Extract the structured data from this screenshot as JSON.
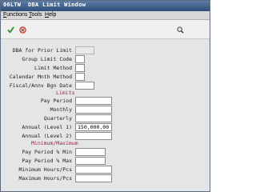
{
  "window": {
    "code": "06LTW",
    "title": "DBA Limit Window"
  },
  "menu": [
    "Functions",
    "Tools",
    "Help"
  ],
  "toolbar": {
    "ok": "check-icon",
    "cancel": "cancel-icon",
    "find": "magnifier-icon"
  },
  "form": {
    "dba_prior_limit": {
      "label": "DBA for Prior Limit",
      "value": ""
    },
    "group_limit_code": {
      "label": "Group Limit Code",
      "value": ""
    },
    "limit_method": {
      "label": "Limit Method",
      "value": ""
    },
    "calendar_month_method": {
      "label": "Calendar Mnth Method",
      "value": ""
    },
    "fiscal_anniv_begin_date": {
      "label": "Fiscal/Annv Bgn Date",
      "value": ""
    },
    "limits_header": "Limits",
    "pay_period": {
      "label": "Pay Period",
      "value": ""
    },
    "monthly": {
      "label": "Monthly",
      "value": ""
    },
    "quarterly": {
      "label": "Quarterly",
      "value": ""
    },
    "annual_level1": {
      "label": "Annual (Level 1)",
      "value": "150,000.00"
    },
    "annual_level2": {
      "label": "Annual (Level 2)",
      "value": ""
    },
    "minmax_header": "Minimum/Maximum",
    "pay_period_pct_min": {
      "label": "Pay Period % Min",
      "value": ""
    },
    "pay_period_pct_max": {
      "label": "Pay Period % Max",
      "value": ""
    },
    "min_hours_pcs": {
      "label": "Minimum Hours/Pcs",
      "value": ""
    },
    "max_hours_pcs": {
      "label": "Maximum Hours/Pcs",
      "value": ""
    }
  },
  "colors": {
    "title_bar": "#2e4e78",
    "section_header": "#a01e4a",
    "ok_icon": "#2f8f2f",
    "cancel_icon": "#c0392b"
  }
}
